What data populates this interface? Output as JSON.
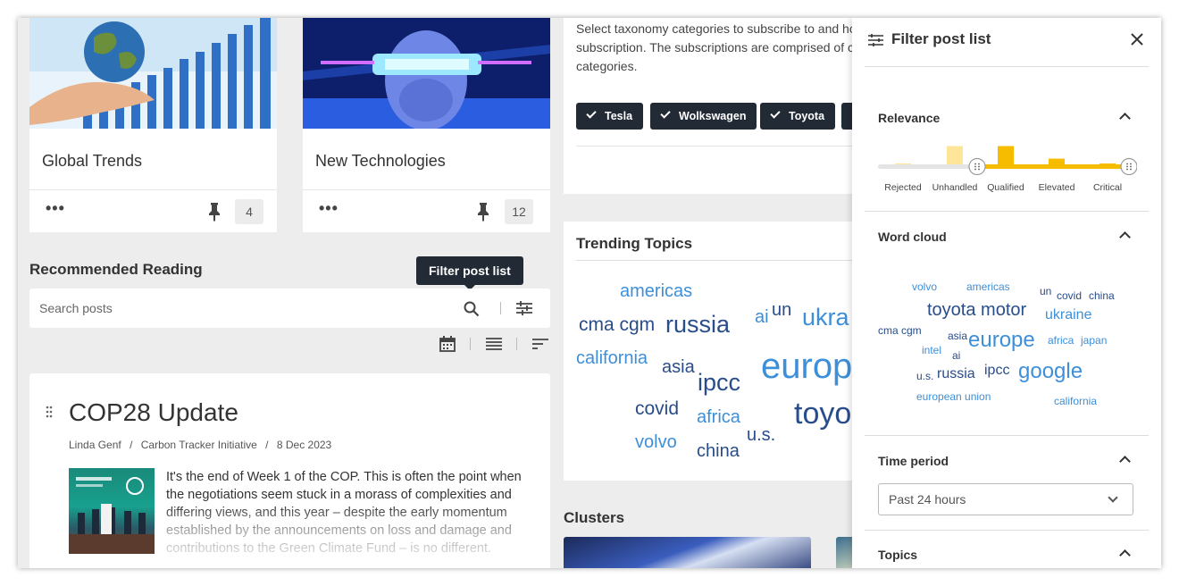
{
  "cards": [
    {
      "title": "Global Trends",
      "count": "4"
    },
    {
      "title": "New Technologies",
      "count": "12"
    }
  ],
  "recommended": {
    "title": "Recommended Reading",
    "search_placeholder": "Search posts",
    "tooltip": "Filter post list"
  },
  "post": {
    "title": "COP28 Update",
    "author": "Linda Genf",
    "source": "Carbon Tracker Initiative",
    "date": "8 Dec 2023",
    "separator": "/",
    "body": "It's the end of Week 1 of the COP. This is often the point when the negotiations seem stuck in a morass of complexities and differing views, and this year – despite the early momentum established by the announcements on loss and damage and contributions to the Green Climate Fund – is no different."
  },
  "subscriptions": {
    "text": "Select taxonomy categories to subscribe to and ho subscription. The subscriptions are comprised of c categories.",
    "chips": [
      "Tesla",
      "Wolkswagen",
      "Toyota"
    ]
  },
  "trending": {
    "title": "Trending Topics",
    "words": [
      {
        "text": "americas"
      },
      {
        "text": "cma cgm"
      },
      {
        "text": "russia"
      },
      {
        "text": "ai"
      },
      {
        "text": "un"
      },
      {
        "text": "ukra"
      },
      {
        "text": "california"
      },
      {
        "text": "asia"
      },
      {
        "text": "ipcc"
      },
      {
        "text": "europ"
      },
      {
        "text": "covid"
      },
      {
        "text": "africa"
      },
      {
        "text": "toyo"
      },
      {
        "text": "volvo"
      },
      {
        "text": "china"
      },
      {
        "text": "u.s."
      }
    ]
  },
  "clusters": {
    "title": "Clusters"
  },
  "filter": {
    "title": "Filter post list",
    "relevance": {
      "title": "Relevance",
      "labels": [
        "Rejected",
        "Unhandled",
        "Qualified",
        "Elevated",
        "Critical"
      ],
      "bars": [
        0.1,
        0.75,
        0.75,
        0.28,
        0.1
      ],
      "range_from": "Unhandled",
      "range_to": "Critical"
    },
    "word_cloud": {
      "title": "Word cloud",
      "words": [
        {
          "text": "volvo"
        },
        {
          "text": "americas"
        },
        {
          "text": "un"
        },
        {
          "text": "covid"
        },
        {
          "text": "china"
        },
        {
          "text": "toyota motor"
        },
        {
          "text": "ukraine"
        },
        {
          "text": "cma cgm"
        },
        {
          "text": "asia"
        },
        {
          "text": "europe"
        },
        {
          "text": "africa"
        },
        {
          "text": "japan"
        },
        {
          "text": "intel"
        },
        {
          "text": "ai"
        },
        {
          "text": "u.s."
        },
        {
          "text": "russia"
        },
        {
          "text": "ipcc"
        },
        {
          "text": "google"
        },
        {
          "text": "european union"
        },
        {
          "text": "california"
        }
      ]
    },
    "time_period": {
      "title": "Time period",
      "value": "Past 24 hours"
    },
    "topics": {
      "title": "Topics"
    }
  },
  "colors": {
    "accent": "#f5bc00",
    "accent_light": "#fde59a",
    "dark": "#222a35",
    "word_blue": "#3d8fd9",
    "word_dark": "#284d8a"
  }
}
